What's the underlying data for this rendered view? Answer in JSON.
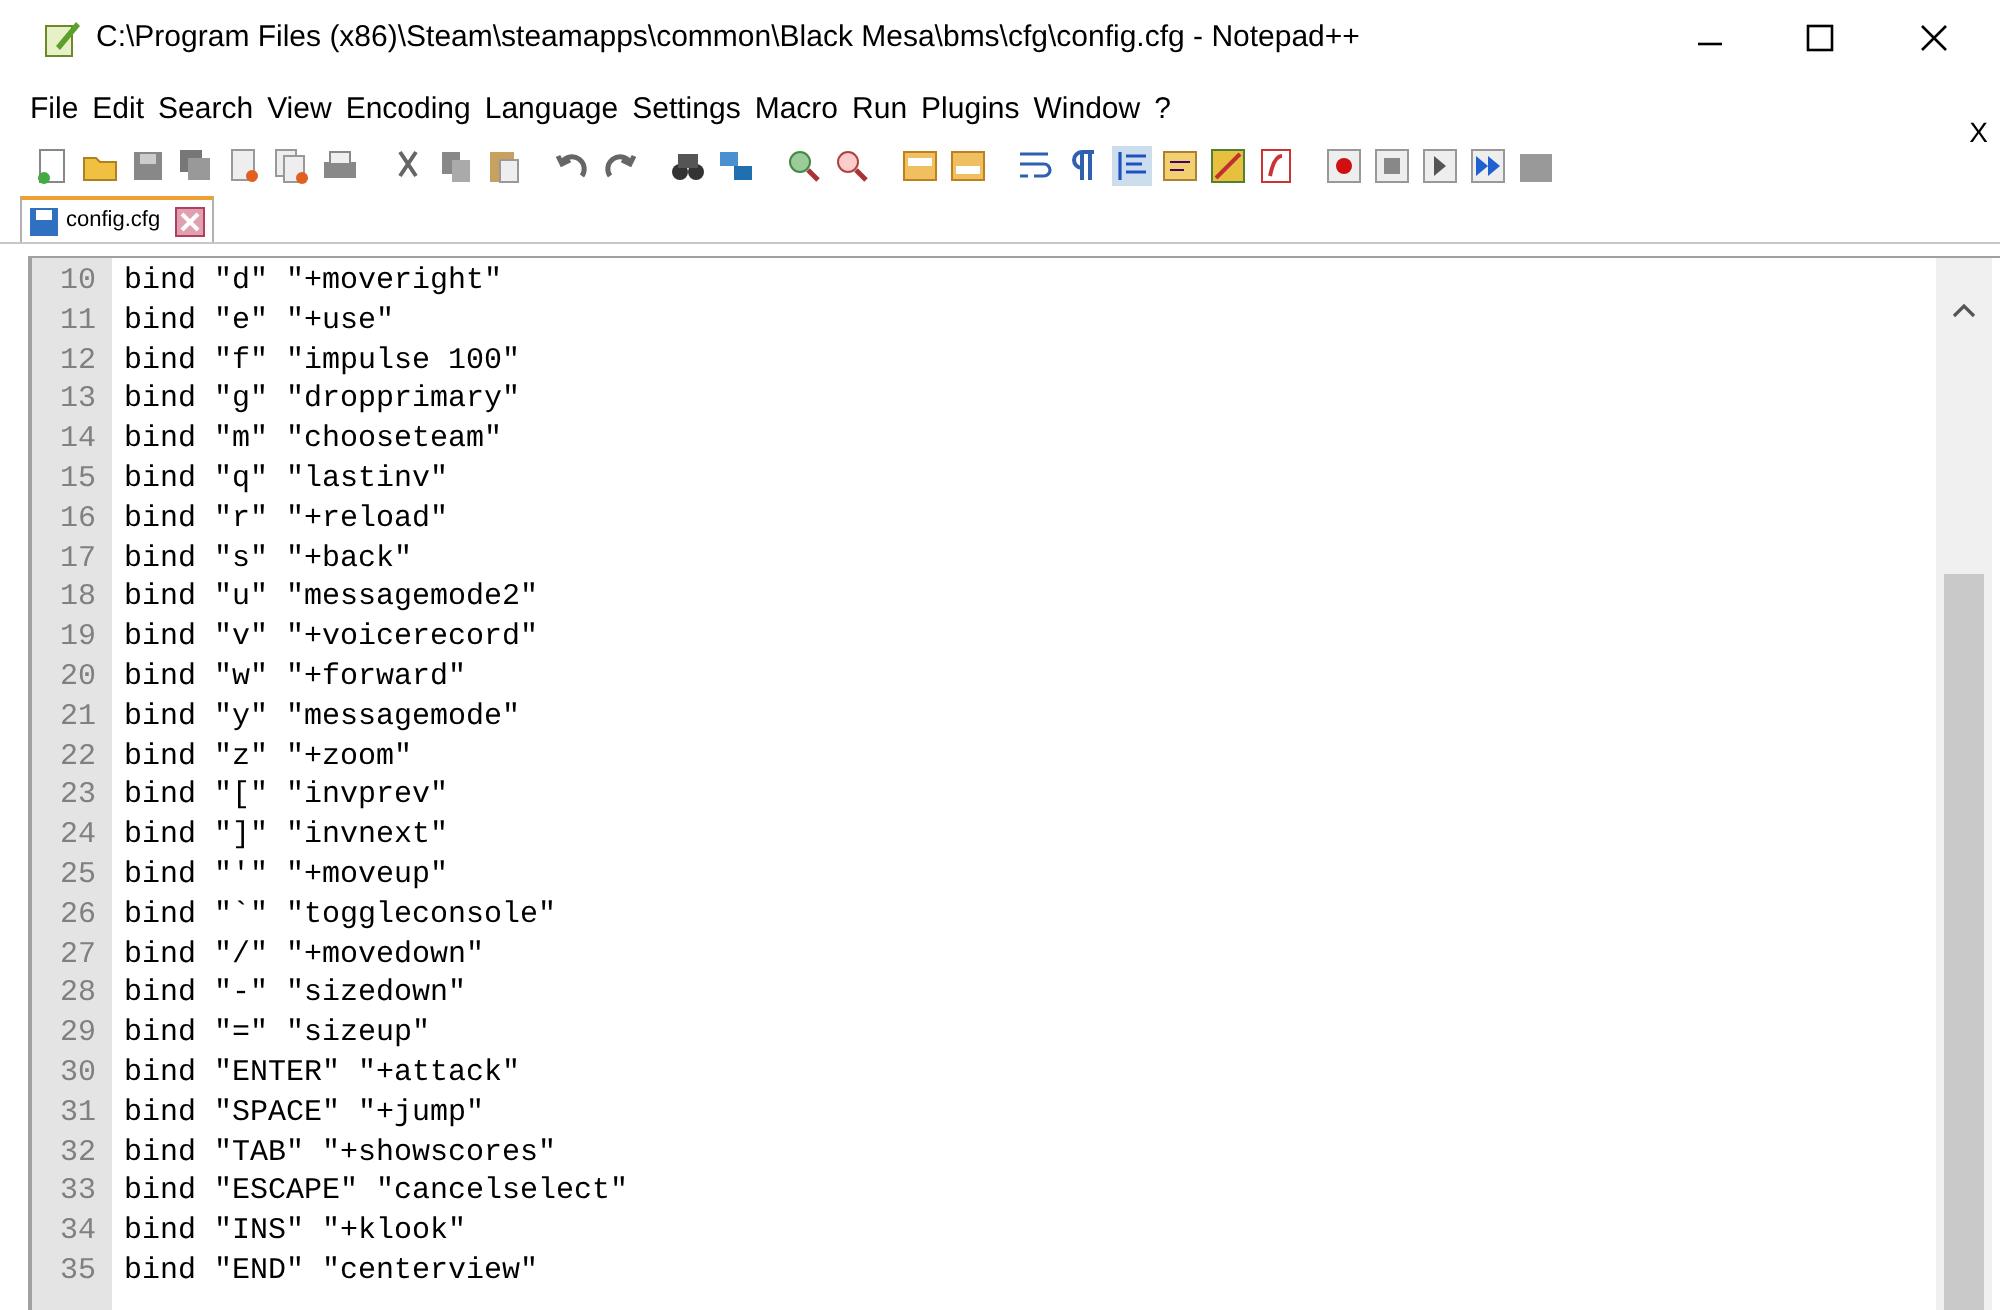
{
  "window": {
    "title": "C:\\Program Files (x86)\\Steam\\steamapps\\common\\Black Mesa\\bms\\cfg\\config.cfg - Notepad++"
  },
  "menu": [
    "File",
    "Edit",
    "Search",
    "View",
    "Encoding",
    "Language",
    "Settings",
    "Macro",
    "Run",
    "Plugins",
    "Window",
    "?"
  ],
  "close_document": "X",
  "tabs": [
    {
      "label": "config.cfg",
      "selected": true
    }
  ],
  "editor": {
    "lines": [
      {
        "number": "10",
        "text": "bind \"d\" \"+moveright\""
      },
      {
        "number": "11",
        "text": "bind \"e\" \"+use\""
      },
      {
        "number": "12",
        "text": "bind \"f\" \"impulse 100\""
      },
      {
        "number": "13",
        "text": "bind \"g\" \"dropprimary\""
      },
      {
        "number": "14",
        "text": "bind \"m\" \"chooseteam\""
      },
      {
        "number": "15",
        "text": "bind \"q\" \"lastinv\""
      },
      {
        "number": "16",
        "text": "bind \"r\" \"+reload\""
      },
      {
        "number": "17",
        "text": "bind \"s\" \"+back\""
      },
      {
        "number": "18",
        "text": "bind \"u\" \"messagemode2\""
      },
      {
        "number": "19",
        "text": "bind \"v\" \"+voicerecord\""
      },
      {
        "number": "20",
        "text": "bind \"w\" \"+forward\""
      },
      {
        "number": "21",
        "text": "bind \"y\" \"messagemode\""
      },
      {
        "number": "22",
        "text": "bind \"z\" \"+zoom\""
      },
      {
        "number": "23",
        "text": "bind \"[\" \"invprev\""
      },
      {
        "number": "24",
        "text": "bind \"]\" \"invnext\""
      },
      {
        "number": "25",
        "text": "bind \"'\" \"+moveup\""
      },
      {
        "number": "26",
        "text": "bind \"`\" \"toggleconsole\""
      },
      {
        "number": "27",
        "text": "bind \"/\" \"+movedown\""
      },
      {
        "number": "28",
        "text": "bind \"-\" \"sizedown\""
      },
      {
        "number": "29",
        "text": "bind \"=\" \"sizeup\""
      },
      {
        "number": "30",
        "text": "bind \"ENTER\" \"+attack\""
      },
      {
        "number": "31",
        "text": "bind \"SPACE\" \"+jump\""
      },
      {
        "number": "32",
        "text": "bind \"TAB\" \"+showscores\""
      },
      {
        "number": "33",
        "text": "bind \"ESCAPE\" \"cancelselect\""
      },
      {
        "number": "34",
        "text": "bind \"INS\" \"+klook\""
      },
      {
        "number": "35",
        "text": "bind \"END\" \"centerview\""
      }
    ]
  }
}
